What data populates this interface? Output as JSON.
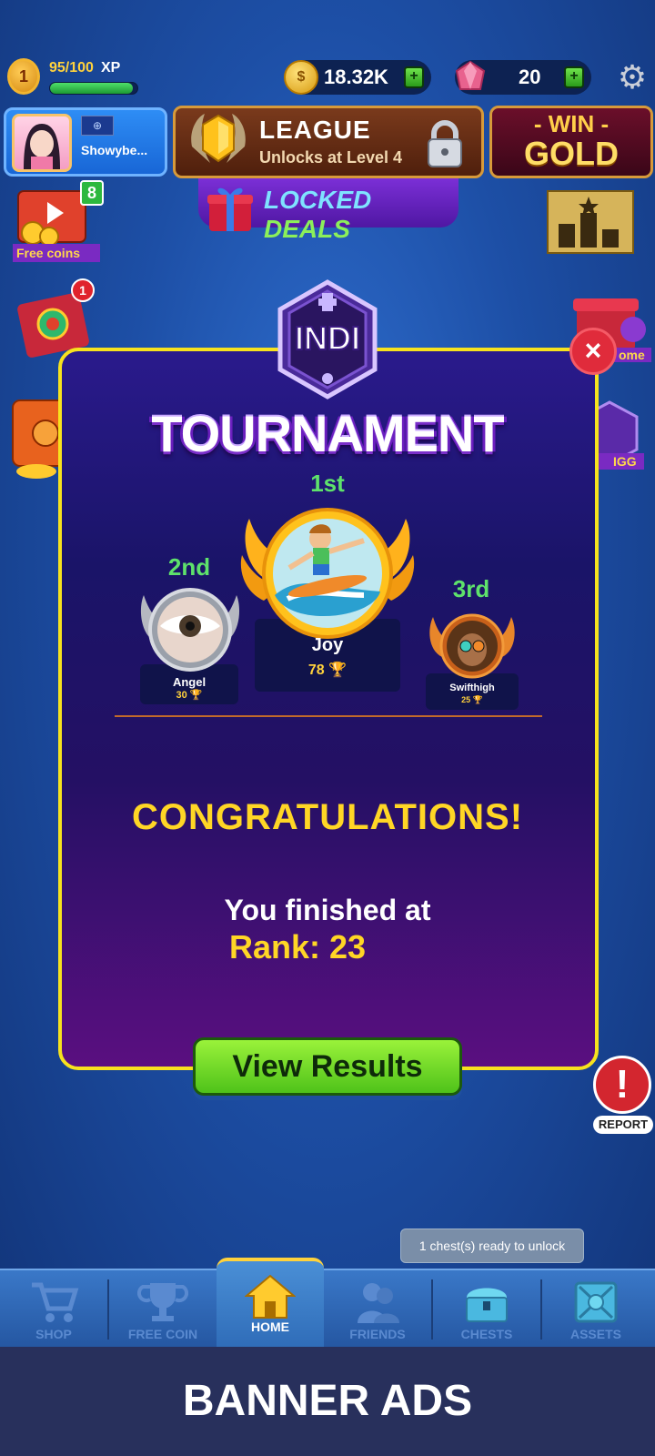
{
  "topbar": {
    "level": "1",
    "xp_value": "95/100",
    "xp_label": "XP",
    "xp_progress": 0.95,
    "coins": "18.32K",
    "gems": "20",
    "plus": "+"
  },
  "profile": {
    "name": "Showybe..."
  },
  "league": {
    "title": "LEAGUE",
    "subtitle": "Unlocks at Level 4"
  },
  "win_gold": {
    "win": "- WIN -",
    "gold": "GOLD"
  },
  "locked_deals": {
    "locked": "LOCKED",
    "deals": "DEALS"
  },
  "side": {
    "free_coins_badge": "8",
    "free_coins_label": "Free coins",
    "super_shot_badge": "1"
  },
  "tournament": {
    "logo_text": "INDI",
    "title": "TOURNAMENT",
    "first": {
      "place": "1st",
      "name": "Joy",
      "score": "78"
    },
    "second": {
      "place": "2nd",
      "name": "Angel",
      "score": "30"
    },
    "third": {
      "place": "3rd",
      "name": "Swifthigh",
      "score": "25"
    },
    "congrats": "CONGRATULATIONS!",
    "finished_text": "You finished at",
    "rank_text": "Rank: 23",
    "view_results": "View Results",
    "close": "×"
  },
  "report": {
    "icon": "!",
    "label": "REPORT"
  },
  "tooltip": "1 chest(s) ready to unlock",
  "nav": {
    "items": [
      {
        "label": "SHOP",
        "icon": "cart-icon"
      },
      {
        "label": "FREE COIN",
        "icon": "trophy-icon"
      },
      {
        "label": "HOME",
        "icon": "home-icon"
      },
      {
        "label": "FRIENDS",
        "icon": "friends-icon"
      },
      {
        "label": "CHESTS",
        "icon": "chest-icon"
      },
      {
        "label": "ASSETS",
        "icon": "assets-icon"
      }
    ],
    "active": "HOME"
  },
  "banner": "BANNER ADS",
  "colors": {
    "accent_yellow": "#ffd625",
    "place_green": "#5ee26b",
    "modal_border": "#f7e21e",
    "button_green": "#7edb2c",
    "close_red": "#e02b3b"
  }
}
